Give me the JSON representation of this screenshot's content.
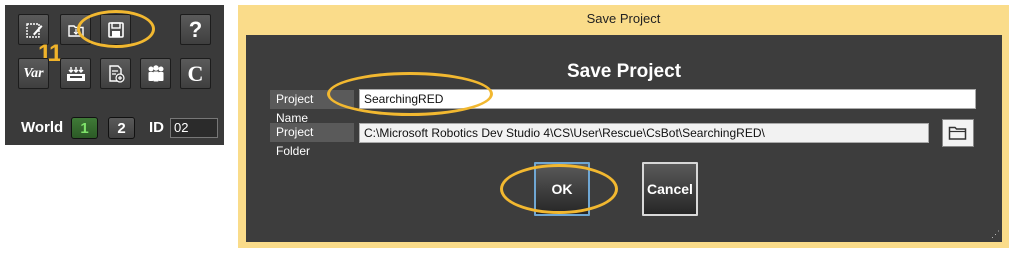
{
  "toolbar": {
    "buttons_row1": [
      {
        "name": "edit-icon"
      },
      {
        "name": "open-folder-icon"
      },
      {
        "name": "save-icon"
      },
      {
        "label": "?",
        "name": "help-icon"
      }
    ],
    "buttons_row2": [
      {
        "label": "Var",
        "name": "variables-icon"
      },
      {
        "name": "tray-icon"
      },
      {
        "name": "document-add-icon"
      },
      {
        "name": "people-icon"
      },
      {
        "label": "C",
        "name": "c-code-icon"
      }
    ],
    "annotation_number": "11",
    "world_label": "World",
    "world_1": "1",
    "world_2": "2",
    "id_label": "ID",
    "id_value": "02"
  },
  "dialog": {
    "title": "Save Project",
    "heading": "Save Project",
    "project_name_label": "Project Name",
    "project_name_value": "SearchingRED",
    "project_folder_label": "Project Folder",
    "project_folder_value": "C:\\Microsoft Robotics Dev Studio 4\\CS\\User\\Rescue\\CsBot\\SearchingRED\\",
    "ok_label": "OK",
    "cancel_label": "Cancel"
  },
  "colors": {
    "annotation": "#f2b830",
    "dialog_frame": "#fadc8a",
    "dialog_body": "#3d3d3d",
    "toolbar_bg": "#3a3a3a",
    "world_active": "#2c5a26"
  }
}
